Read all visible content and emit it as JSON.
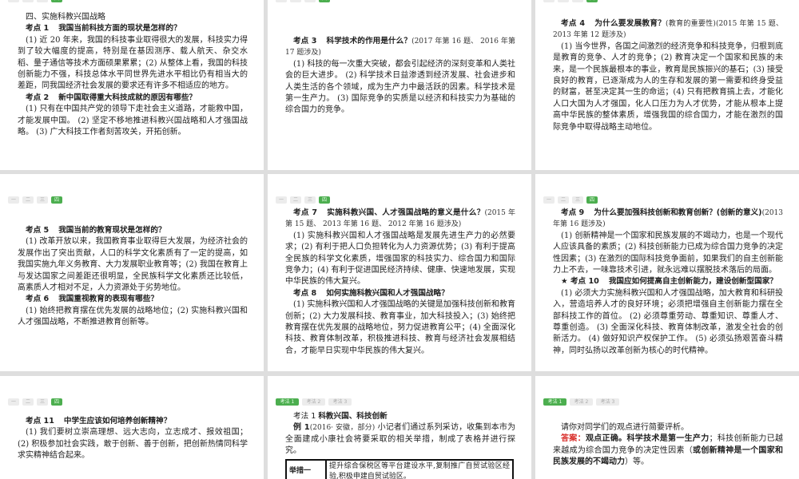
{
  "tabs_num": [
    "一",
    "二",
    "三",
    "四"
  ],
  "tabs_method": [
    "考法 1",
    "考法 2",
    "考法 3"
  ],
  "p1": {
    "section": "四、实施科教兴国战略",
    "h1_label": "考点 1",
    "h1_q": "我国当前科技方面的现状是怎样的？",
    "b1": "(1) 近 20 年来，我国的科技事业取得很大的发展，科技实力得到了较大幅度的提高，特别是在基因测序、载人航天、杂交水稻、量子通信等技术方面硕果累累；(2) 从整体上看，我国的科技创新能力不强，科技总体水平同世界先进水平相比仍有相当大的差距，同我国经济社会发展的要求还有许多不相适应的地方。",
    "h2_label": "考点 2",
    "h2_q": "新中国取得重大科技成就的原因有哪些？",
    "b2": "(1) 只有在中国共产党的领导下走社会主义道路，才能救中国，才能发展中国。 (2) 坚定不移地推进科教兴国战略和人才强国战略。 (3) 广大科技工作者刻苦攻关，开拓创新。"
  },
  "p2": {
    "h_label": "考点 3",
    "h_q": "科学技术的作用是什么？",
    "h_note": "(2017 年第 16 题、 2016 年第 17 题涉及)",
    "b": "(1) 科技的每一次重大突破，都会引起经济的深刻变革和人类社会的巨大进步。 (2) 科学技术日益渗透到经济发展、社会进步和人类生活的各个领域，成为生产力中最活跃的因素。科学技术是第一生产力。 (3) 国际竞争的实质是以经济和科技实力为基础的综合国力的竞争。"
  },
  "p3": {
    "h_label": "考点 4",
    "h_q": "为什么要发展教育？",
    "h_note": "(教育的重要性)(2015 年第 15 题、 2013 年第 12 题涉及)",
    "b": "(1) 当今世界，各国之间激烈的经济竞争和科技竞争，归根到底是教育的竞争、人才的竞争；(2) 教育决定一个国家和民族的未来，是一个民族最根本的事业，教育是民族振兴的基石；(3) 接受良好的教育，已逐渐成为人的生存和发展的第一需要和终身受益的财富，甚至决定其一生的命运；(4) 只有把教育搞上去，才能化人口大国为人才强国，化人口压力为人才优势，才能从根本上提高中华民族的整体素质，增强我国的综合国力，才能在激烈的国际竞争中取得战略主动地位。"
  },
  "p4": {
    "h1_label": "考点 5",
    "h1_q": "我国当前的教育现状是怎样的？",
    "b1": "(1) 改革开放以来，我国教育事业取得巨大发展，为经济社会的发展作出了突出贡献，人口的科学文化素质有了一定的提高，如我国实施九年义务教育、大力发展职业教育等；(2) 我国在教育上与发达国家之间差距还很明显，全民族科学文化素质还比较低，高素质人才相对不足，人力资源处于劣势地位。",
    "h2_label": "考点 6",
    "h2_q": "我国重视教育的表现有哪些？",
    "b2": "(1) 始终把教育摆在优先发展的战略地位；(2) 实施科教兴国和人才强国战略，不断推进教育创新等。"
  },
  "p5": {
    "h1_label": "考点 7",
    "h1_q": "实施科教兴国、人才强国战略的意义是什么？",
    "h1_note": "(2015 年第 15 题、 2013 年第 16 题、 2012 年第 16 题涉及)",
    "b1": "(1) 实施科教兴国和人才强国战略是发展先进生产力的必然要求；(2) 有利于把人口负担转化为人力资源优势；(3) 有利于提高全民族的科学文化素质，增强国家的科技实力、综合国力和国际竞争力；(4) 有利于促进国民经济持续、健康、快速地发展，实现中华民族的伟大复兴。",
    "h2_label": "考点 8",
    "h2_q": "如何实施科教兴国和人才强国战略？",
    "b2": "(1) 实施科教兴国和人才强国战略的关键是加强科技创新和教育创新；(2) 大力发展科技、教育事业，加大科技投入；(3) 始终把教育摆在优先发展的战略地位，努力促进教育公平；(4) 全面深化科技、教育体制改革，积极推进科技、教育与经济社会发展相结合，才能早日实现中华民族的伟大复兴。"
  },
  "p6": {
    "h1_label": "考点 9",
    "h1_q": "为什么要加强科技创新和教育创新？(创新的意义)",
    "h1_note": "(2013 年第 16 题涉及)",
    "b1": "(1) 创新精神是一个国家和民族发展的不竭动力，也是一个现代人应该具备的素质；(2) 科技创新能力已成为综合国力竞争的决定性因素；(3) 在激烈的国际科技竞争面前，如果我们的自主创新能力上不去，一味靠技术引进，就永远难以摆脱技术落后的局面。",
    "h2_label": "★ 考点 10",
    "h2_q": "我国应如何提高自主创新能力，建设创新型国家？",
    "b2": "(1) 必须大力实施科教兴国和人才强国战略，加大教育和科研投入，营造培养人才的良好环境；必须把增强自主创新能力摆在全部科技工作的首位。 (2) 必须尊重劳动、尊重知识、尊重人才、尊重创造。 (3) 全面深化科技、教育体制改革，激发全社会的创新活力。 (4) 做好知识产权保护工作。 (5) 必须弘扬艰苦奋斗精神，同时弘扬以改革创新为核心的时代精神。"
  },
  "p7": {
    "h_label": "考点 11",
    "h_q": "中学生应该如何培养创新精神？",
    "b": "(1) 我们要树立崇高理想、远大志向，立志成才、报效祖国；(2) 积极参加社会实践，敢于创新、善于创新，把创新热情同科学求实精神结合起来。"
  },
  "p8": {
    "h_label": "考法 1",
    "h_q": "科教兴国、科技创新",
    "ex_label": "例 1",
    "ex_note": "(2016· 安徽，部分)",
    "ex_text": "小记者们通过系列采访，收集到本市为全面建成小康社会将要采取的相关举措，制成了表格并进行探究。",
    "table": [
      {
        "key": "举措一",
        "value": "提升综合保税区等平台建设水平,复制推广自贸试验区经验,积极申建自贸试验区。"
      }
    ]
  },
  "p9": {
    "q": "请你对同学们的观点进行简要评析。",
    "ans_label": "答案：",
    "ans_bold1": "观点正确。科学技术是第一生产力",
    "ans_text1": "；科技创新能力已越来越成为综合国力竞争的决定性因素（",
    "ans_bold2": "或创新精神是一个国家和民族发展的不竭动力",
    "ans_text2": "）等。"
  }
}
